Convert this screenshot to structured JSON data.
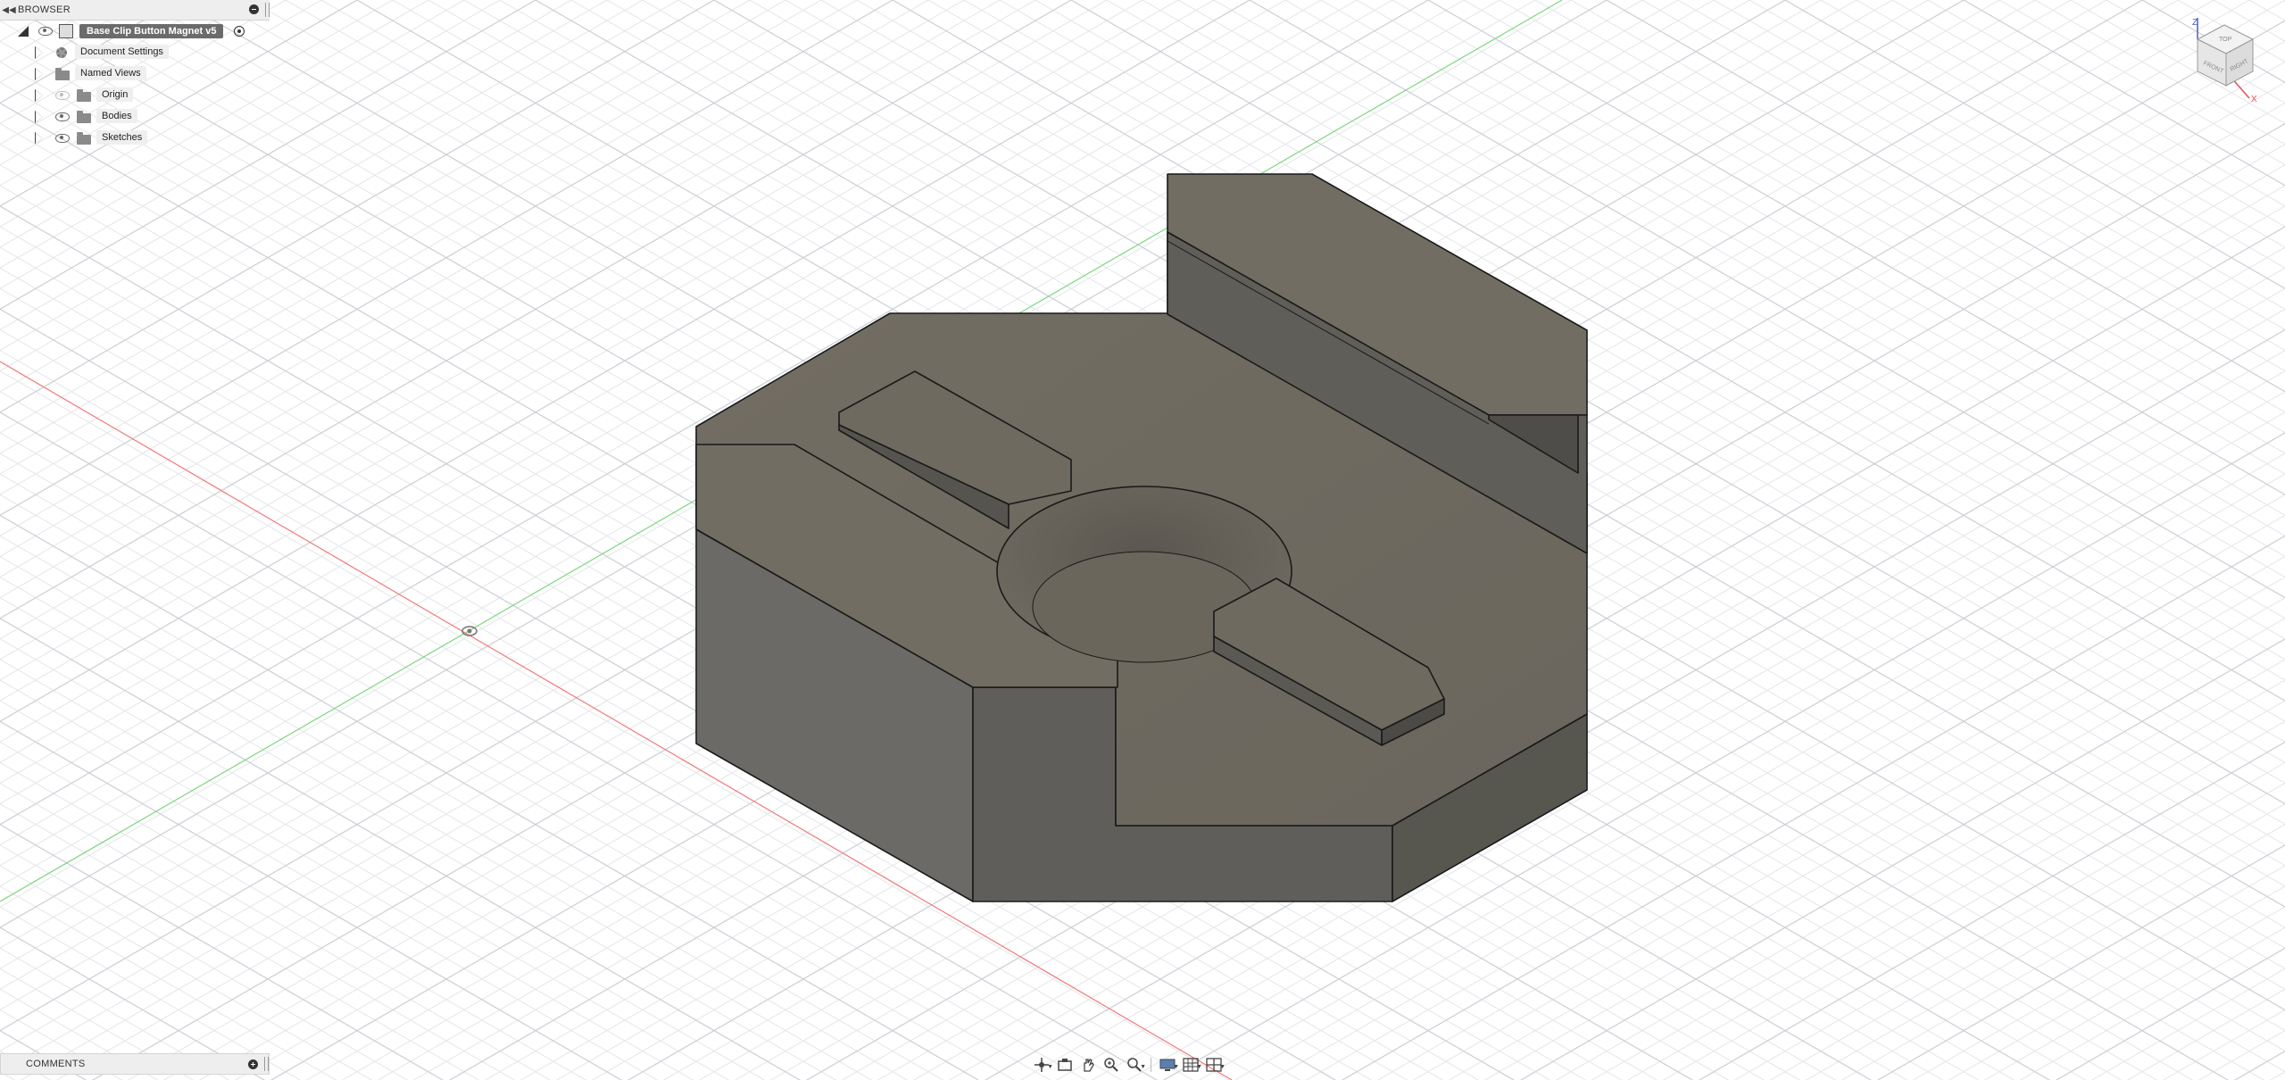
{
  "browser": {
    "title": "BROWSER",
    "root": {
      "label": "Base Clip Button Magnet v5"
    },
    "items": [
      {
        "label": "Document Settings",
        "icon": "gear-icon"
      },
      {
        "label": "Named Views",
        "icon": "folder-icon"
      },
      {
        "label": "Origin",
        "icon": "folder-icon",
        "visibility": "hidden"
      },
      {
        "label": "Bodies",
        "icon": "folder-icon",
        "visibility": "visible"
      },
      {
        "label": "Sketches",
        "icon": "folder-icon",
        "visibility": "visible"
      }
    ]
  },
  "comments": {
    "title": "COMMENTS"
  },
  "viewcube": {
    "top": "TOP",
    "front": "FRONT",
    "right": "RIGHT",
    "axis_z": "Z",
    "axis_x": "X"
  },
  "colors": {
    "grid_minor": "#e4e6ea",
    "grid_major": "#c9ccd2",
    "axis_x": "#f07a7a",
    "axis_y": "#7ed67e",
    "part_top": "#726d62",
    "part_side_dark": "#5c5b57",
    "part_side_light": "#6b6a66",
    "edge": "#1a1a1a"
  }
}
